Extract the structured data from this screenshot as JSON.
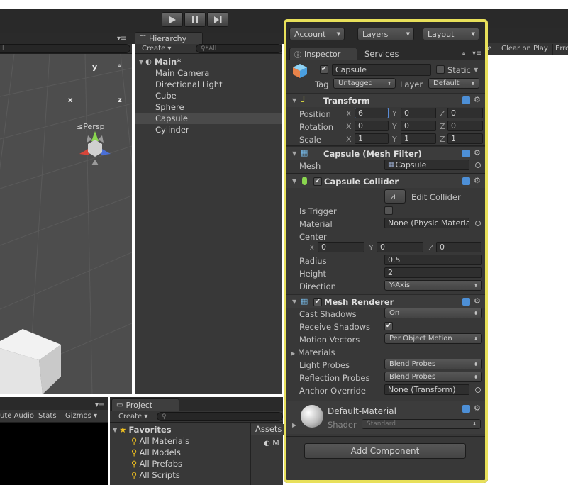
{
  "toolbar": {
    "account": "Account",
    "layers": "Layers",
    "layout": "Layout"
  },
  "hierarchy": {
    "tab": "Hierarchy",
    "create": "Create",
    "search_placeholder": "All",
    "scene_name": "Main*",
    "items": [
      "Main Camera",
      "Directional Light",
      "Cube",
      "Sphere",
      "Capsule",
      "Cylinder"
    ],
    "selected_index": 4
  },
  "scene_view": {
    "gizmo_x": "x",
    "gizmo_y": "y",
    "gizmo_z": "z",
    "persp": "Persp"
  },
  "console_strip": {
    "clear_on_play": "Clear on Play",
    "error_pause": "Erro",
    "e_partial": "e"
  },
  "game_toolbar": {
    "mute_audio": "ute Audio",
    "stats": "Stats",
    "gizmos": "Gizmos"
  },
  "project": {
    "tab": "Project",
    "create": "Create",
    "favorites": "Favorites",
    "favorites_items": [
      "All Materials",
      "All Models",
      "All Prefabs",
      "All Scripts"
    ],
    "assets": "Assets",
    "assets_item": "M"
  },
  "inspector": {
    "tabs": [
      "Inspector",
      "Services"
    ],
    "object_name": "Capsule",
    "static_label": "Static",
    "tag_label": "Tag",
    "tag_value": "Untagged",
    "layer_label": "Layer",
    "layer_value": "Default",
    "transform": {
      "title": "Transform",
      "rows": [
        {
          "label": "Position",
          "x": "6",
          "y": "0",
          "z": "0"
        },
        {
          "label": "Rotation",
          "x": "0",
          "y": "0",
          "z": "0"
        },
        {
          "label": "Scale",
          "x": "1",
          "y": "1",
          "z": "1"
        }
      ],
      "axis_x": "X",
      "axis_y": "Y",
      "axis_z": "Z"
    },
    "mesh_filter": {
      "title": "Capsule (Mesh Filter)",
      "mesh_label": "Mesh",
      "mesh_value": "Capsule"
    },
    "capsule_collider": {
      "title": "Capsule Collider",
      "edit_collider": "Edit Collider",
      "is_trigger": "Is Trigger",
      "material": "Material",
      "material_value": "None (Physic Materia",
      "center": "Center",
      "center_x": "0",
      "center_y": "0",
      "center_z": "0",
      "radius": "Radius",
      "radius_value": "0.5",
      "height": "Height",
      "height_value": "2",
      "direction": "Direction",
      "direction_value": "Y-Axis"
    },
    "mesh_renderer": {
      "title": "Mesh Renderer",
      "cast_shadows": "Cast Shadows",
      "cast_shadows_value": "On",
      "receive_shadows": "Receive Shadows",
      "motion_vectors": "Motion Vectors",
      "motion_vectors_value": "Per Object Motion",
      "materials": "Materials",
      "light_probes": "Light Probes",
      "light_probes_value": "Blend Probes",
      "reflection_probes": "Reflection Probes",
      "reflection_probes_value": "Blend Probes",
      "anchor_override": "Anchor Override",
      "anchor_override_value": "None (Transform)"
    },
    "material": {
      "name": "Default-Material",
      "shader_label": "Shader",
      "shader_value": "Standard"
    },
    "add_component": "Add Component"
  },
  "colors": {
    "highlight_border": "#e8e05a",
    "editor_bg": "#383838",
    "selected_row": "#4a4a4a"
  }
}
